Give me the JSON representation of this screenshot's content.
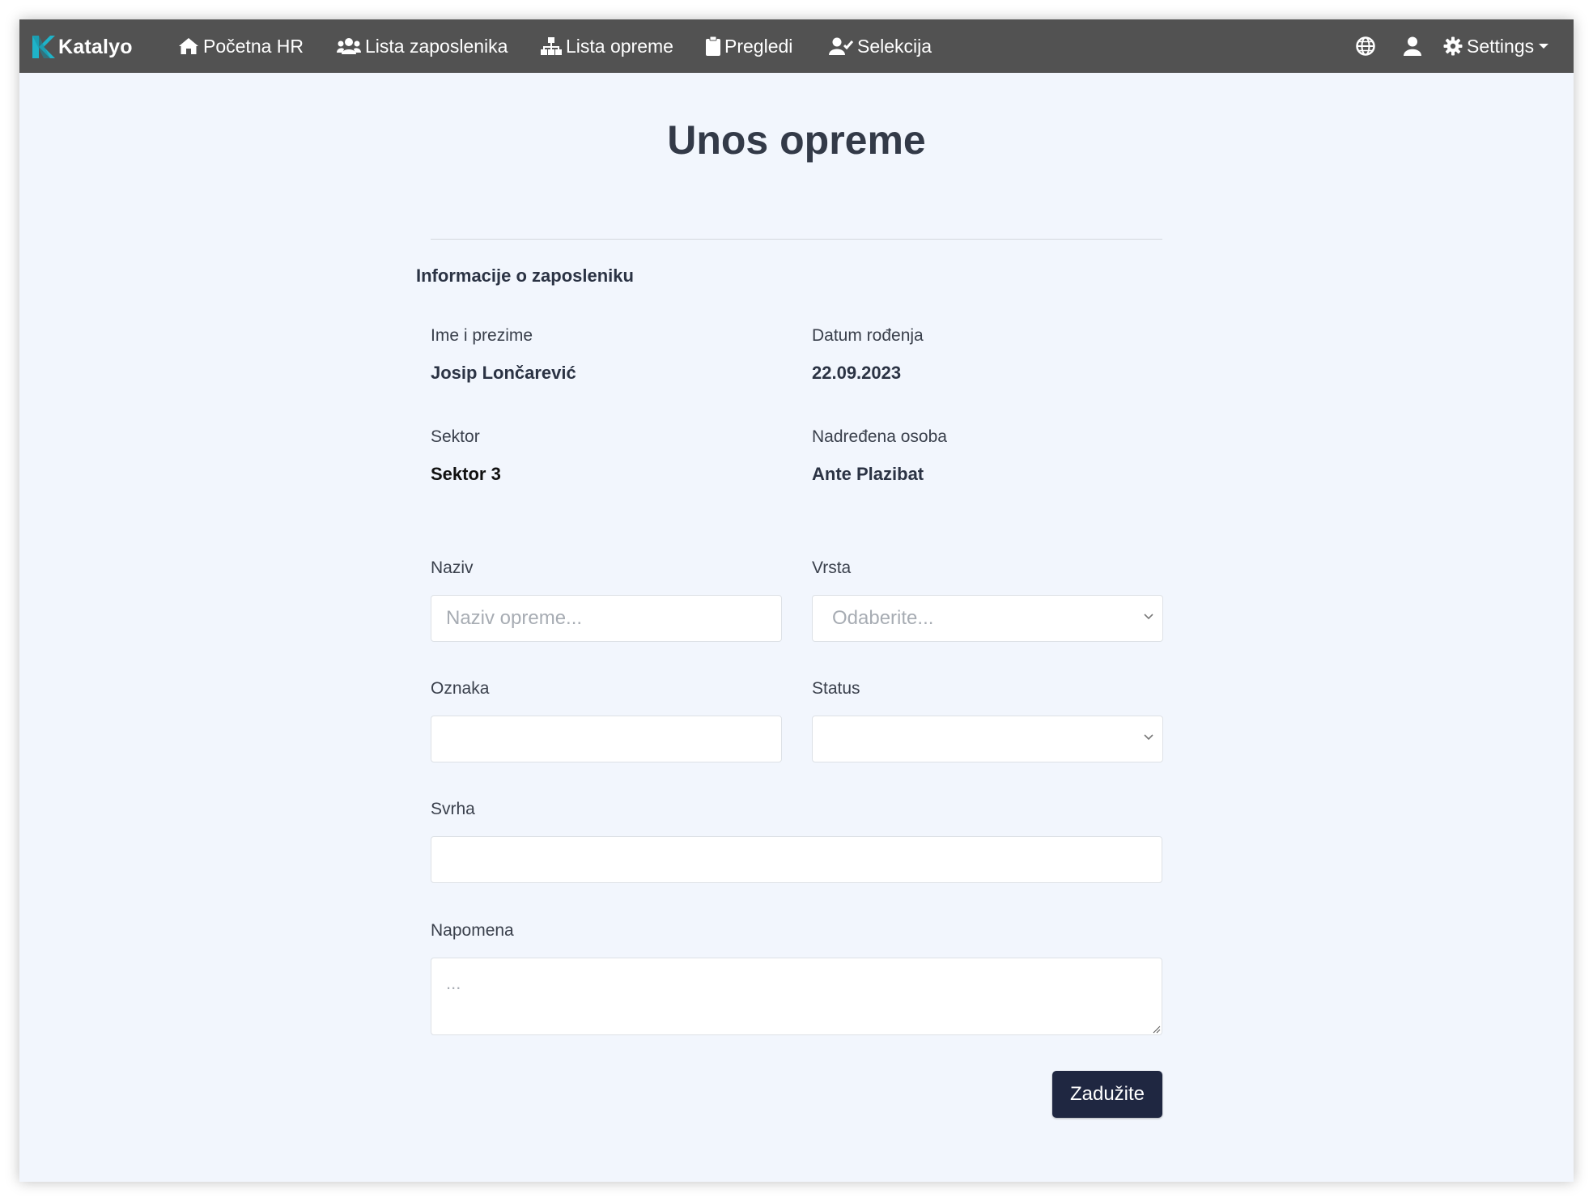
{
  "navbar": {
    "brand": "Katalyo",
    "items": [
      {
        "label": "Početna HR",
        "icon": "home-icon"
      },
      {
        "label": "Lista zaposlenika",
        "icon": "users-icon"
      },
      {
        "label": "Lista opreme",
        "icon": "sitemap-icon"
      },
      {
        "label": "Pregledi",
        "icon": "clipboard-icon"
      },
      {
        "label": "Selekcija",
        "icon": "user-check-icon"
      }
    ],
    "right": {
      "language_icon": "globe-icon",
      "user_icon": "user-icon",
      "settings_label": "Settings",
      "settings_icon": "gear-icon"
    }
  },
  "page": {
    "title": "Unos opreme"
  },
  "employee_info": {
    "section_title": "Informacije o zaposleniku",
    "name_label": "Ime i prezime",
    "name_value": "Josip Lončarević",
    "dob_label": "Datum rođenja",
    "dob_value": "22.09.2023",
    "sector_label": "Sektor",
    "sector_value": "Sektor 3",
    "supervisor_label": "Nadređena osoba",
    "supervisor_value": "Ante Plazibat"
  },
  "form": {
    "naziv_label": "Naziv",
    "naziv_placeholder": "Naziv opreme...",
    "naziv_value": "",
    "vrsta_label": "Vrsta",
    "vrsta_placeholder": "Odaberite...",
    "oznaka_label": "Oznaka",
    "oznaka_value": "",
    "status_label": "Status",
    "status_value": "",
    "svrha_label": "Svrha",
    "svrha_value": "",
    "napomena_label": "Napomena",
    "napomena_placeholder": "...",
    "submit_label": "Zadužite"
  },
  "colors": {
    "navbar_bg": "#525252",
    "page_bg": "#f2f6fd",
    "brand_accent": "#1fb3c8",
    "submit_bg": "#1f2741"
  }
}
